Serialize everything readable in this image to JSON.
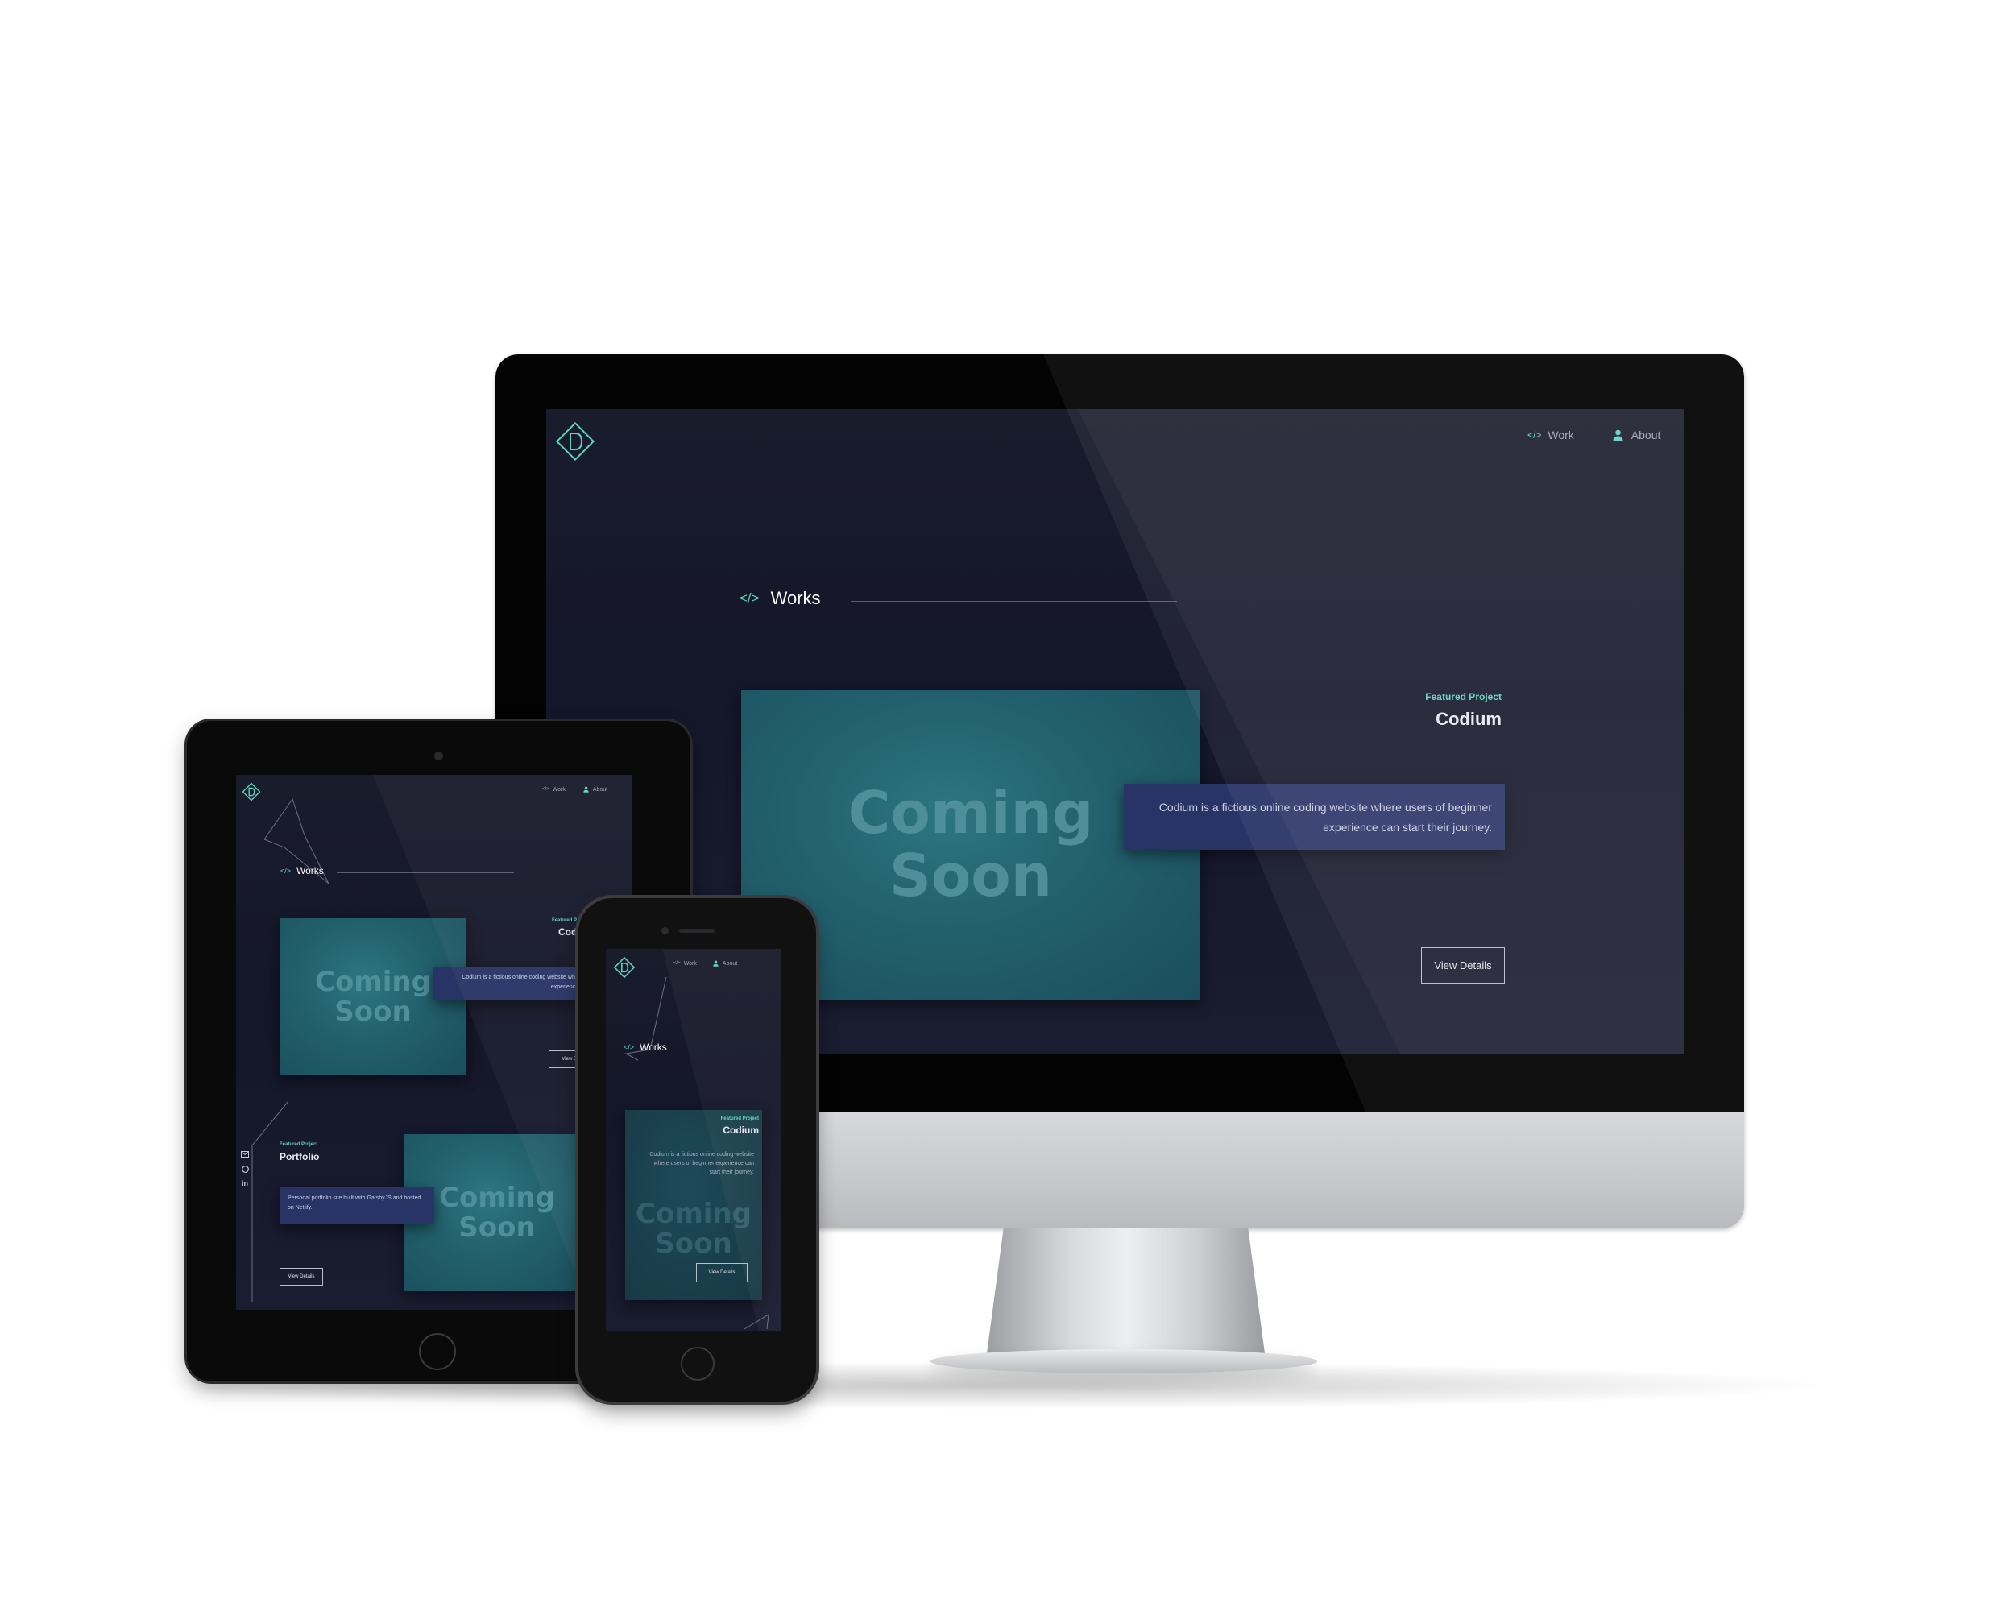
{
  "brand": {
    "logo_letter": "D",
    "accent": "#5fd2c4",
    "background": "#14162a",
    "card_color": "#283366"
  },
  "nav": {
    "work_label": "Work",
    "about_label": "About",
    "work_icon": "code-icon",
    "about_icon": "user-icon"
  },
  "section": {
    "title": "Works",
    "icon": "code-icon"
  },
  "projects": [
    {
      "featured_label": "Featured Project",
      "title": "Codium",
      "description": "Codium is a fictious online coding website where users of beginner experience can start their journey.",
      "image_text_line1": "Coming",
      "image_text_line2": "Soon",
      "button_label": "View Details"
    },
    {
      "featured_label": "Featured Project",
      "title": "Portfolio",
      "description": "Personal portfolio site built with GatsbyJS and hosted on Netlify.",
      "image_text_line1": "Coming",
      "image_text_line2": "Soon",
      "button_label": "View Details"
    }
  ],
  "tablet_partial": {
    "featured_label": "Featured P",
    "title": "Cod",
    "description": "Codium is a fictious online coding website where users of beginner experience can start their journ",
    "button_label": "View Deta"
  },
  "social": {
    "icons": [
      "mail-icon",
      "github-icon",
      "linkedin-icon"
    ],
    "linkedin_text": "in"
  }
}
